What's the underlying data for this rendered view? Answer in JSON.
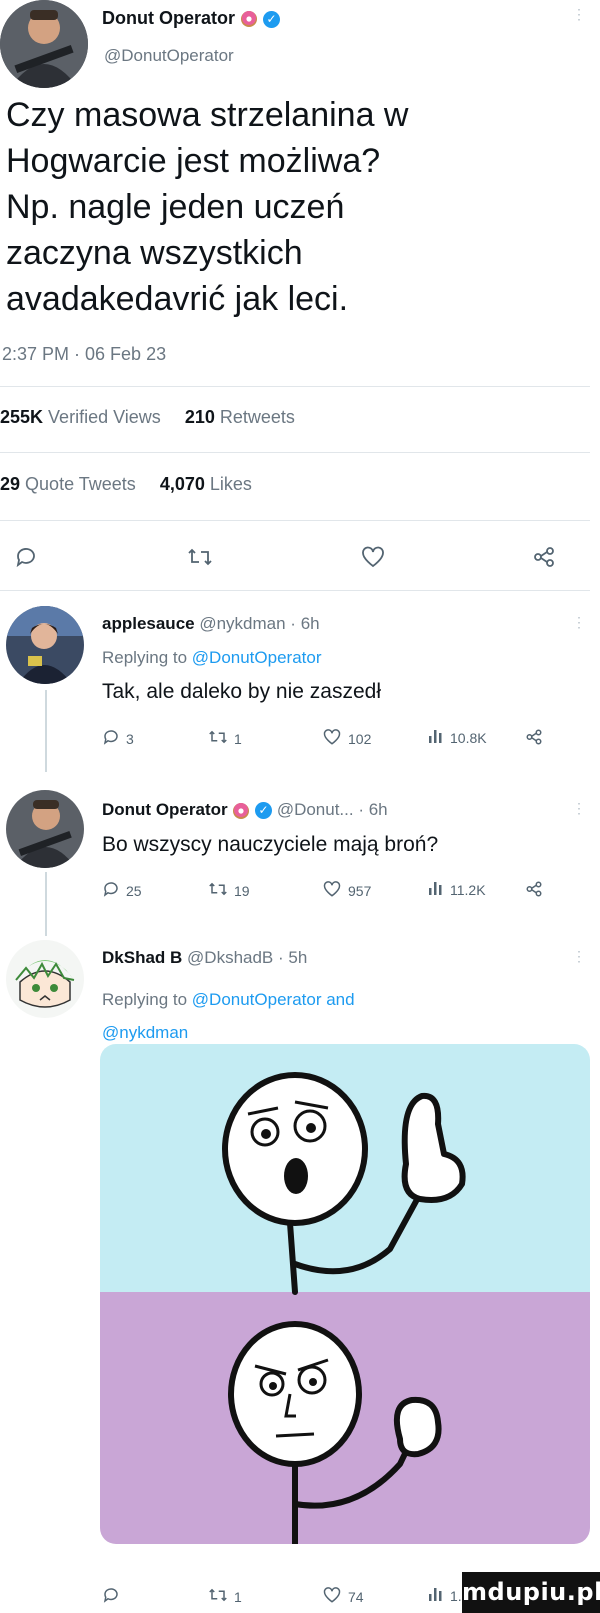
{
  "main_tweet": {
    "author_name": "Donut Operator",
    "author_handle": "@DonutOperator",
    "text_lines": [
      "Czy masowa strzelanina w",
      "Hogwarcie jest możliwa?",
      "Np. nagle jeden uczeń",
      "zaczyna wszystkich",
      "avadakedavrić jak leci."
    ],
    "timestamp": "2:37 PM · 06 Feb 23",
    "views_count": "255K",
    "views_label": "Verified Views",
    "retweets_count": "210",
    "retweets_label": "Retweets",
    "quotes_count": "29",
    "quotes_label": "Quote Tweets",
    "likes_count": "4,070",
    "likes_label": "Likes"
  },
  "replies": [
    {
      "name": "applesauce",
      "meta": "@nykdman · 6h",
      "replying_prefix": "Replying to ",
      "replying_to": "@DonutOperator",
      "text": "Tak, ale daleko by nie zaszedł",
      "stats": {
        "replies": "3",
        "retweets": "1",
        "likes": "102",
        "views": "10.8K"
      }
    },
    {
      "name": "Donut Operator",
      "meta": "@Donut... · 6h",
      "text": "Bo wszyscy nauczyciele mają broń?",
      "stats": {
        "replies": "25",
        "retweets": "19",
        "likes": "957",
        "views": "11.2K"
      }
    },
    {
      "name": "DkShad B",
      "meta": "@DkshadB · 5h",
      "replying_prefix": "Replying to ",
      "replying_to_line1": "@DonutOperator and",
      "replying_to_line2": "@nykdman",
      "stats": {
        "retweets": "1",
        "likes": "74",
        "views": "1.1"
      }
    }
  ],
  "watermark": "mdupiu.pl",
  "colors": {
    "link": "#1d9bf0",
    "meme_top": "#c4ecf3",
    "meme_bottom": "#c9a6d6"
  },
  "icons": [
    "reply-icon",
    "retweet-icon",
    "like-icon",
    "share-icon",
    "views-icon",
    "verified-icon",
    "donut-icon",
    "kebab-icon"
  ]
}
